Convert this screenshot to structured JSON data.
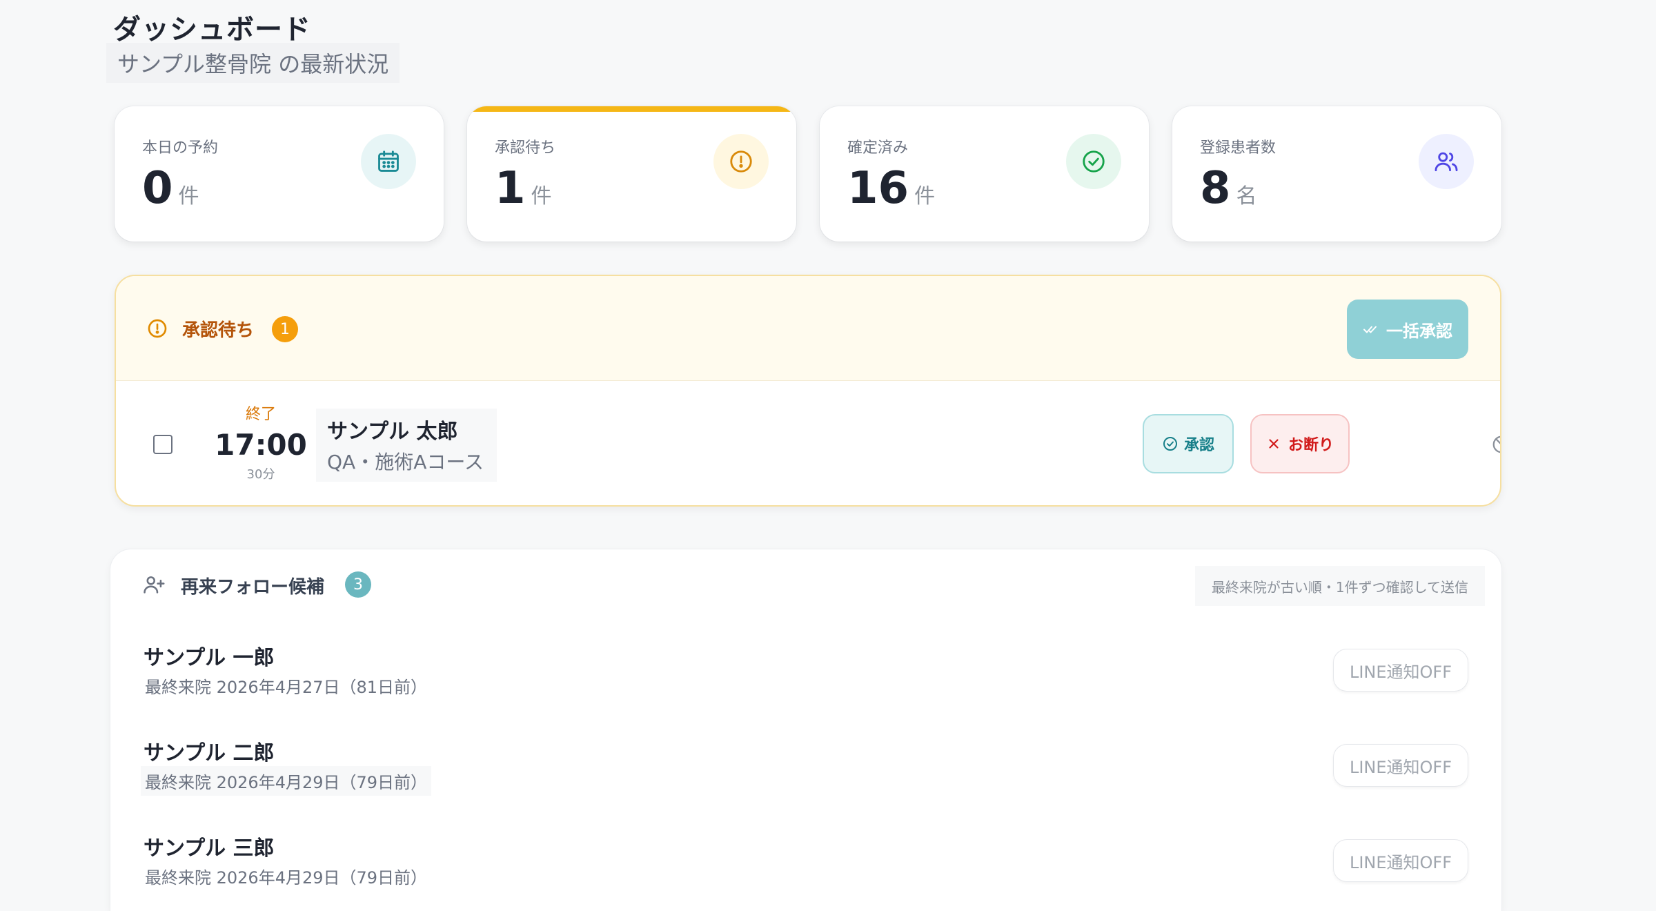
{
  "header": {
    "title": "ダッシュボード",
    "subtitle": "サンプル整骨院 の最新状況"
  },
  "stats": [
    {
      "label": "本日の予約",
      "value": "0",
      "unit": "件",
      "icon": "calendar-icon"
    },
    {
      "label": "承認待ち",
      "value": "1",
      "unit": "件",
      "icon": "alert-circle-icon"
    },
    {
      "label": "確定済み",
      "value": "16",
      "unit": "件",
      "icon": "check-circle-icon"
    },
    {
      "label": "登録患者数",
      "value": "8",
      "unit": "名",
      "icon": "users-icon"
    }
  ],
  "pending": {
    "title": "承認待ち",
    "count": "1",
    "bulk_approve_label": "一括承認",
    "rows": [
      {
        "status": "終了",
        "time": "17:00",
        "duration": "30分",
        "patient_name": "サンプル 太郎",
        "course": "QA・施術Aコース",
        "approve_label": "承認",
        "decline_label": "お断り"
      }
    ]
  },
  "follow": {
    "title": "再来フォロー候補",
    "count": "3",
    "note": "最終来院が古い順・1件ずつ確認して送信",
    "items": [
      {
        "name": "サンプル 一郎",
        "last_visit": "最終来院 2026年4月27日（81日前）",
        "button": "LINE通知OFF"
      },
      {
        "name": "サンプル 二郎",
        "last_visit": "最終来院 2026年4月29日（79日前）",
        "button": "LINE通知OFF"
      },
      {
        "name": "サンプル 三郎",
        "last_visit": "最終来院 2026年4月29日（79日前）",
        "button": "LINE通知OFF"
      }
    ]
  },
  "colors": {
    "accent_yellow": "#f5b716",
    "teal": "#1a8a95",
    "danger": "#d11a1a"
  }
}
